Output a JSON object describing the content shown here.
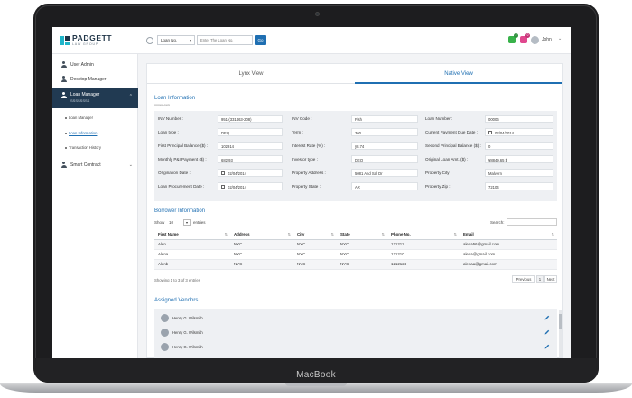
{
  "device": {
    "brand_label": "MacBook"
  },
  "header": {
    "logo_name": "PADGETT",
    "logo_sub": "LAW GROUP",
    "search_type": "Loan No.",
    "search_placeholder": "Enter The Loan No.",
    "go_label": "Go",
    "notif_green_count": "2",
    "notif_pink_count": "0",
    "user_name": "John",
    "accent_color": "#1f6fb2"
  },
  "sidebar": {
    "user_admin": "User Admin",
    "desktop_manager": "Desktop Manager",
    "loan_manager": "Loan Manager",
    "loan_manager_sub": "SSSSSSSS",
    "sub_items": [
      "Loan Manager",
      "Loan Information",
      "Transaction History"
    ],
    "smart_contract": "Smart Contract"
  },
  "tabs": {
    "lynx": "Lynx View",
    "native": "Native View"
  },
  "loan_info": {
    "title": "Loan Information",
    "subtitle": "000694/65",
    "fields": {
      "inv_number": {
        "label": "INV Number :",
        "value": "951-(331463-208)"
      },
      "inv_code": {
        "label": "INV Code :",
        "value": "Fish"
      },
      "loan_number": {
        "label": "Loan Number :",
        "value": "00006"
      },
      "loan_type": {
        "label": "Loan type :",
        "value": "DEQ"
      },
      "term": {
        "label": "Term :",
        "value": "360"
      },
      "payment_due": {
        "label": "Current Payment Due Date :",
        "value": "02/04/2014"
      },
      "first_principal": {
        "label": "First Principal Balance ($) :",
        "value": "102914"
      },
      "interest_rate": {
        "label": "Interest Rate (%) :",
        "value": "ÿ8.74"
      },
      "second_principal": {
        "label": "Second Principal Balance ($) :",
        "value": "0"
      },
      "monthly_payment": {
        "label": "Monthly P&I Payment ($) :",
        "value": "682.93"
      },
      "investor_type": {
        "label": "Investor type :",
        "value": "DEQ"
      },
      "original_loan": {
        "label": "Original Loan Amt. ($) :",
        "value": "¥8849.65 $"
      },
      "origination_date": {
        "label": "Origination Date :",
        "value": "02/04/2014"
      },
      "property_address": {
        "label": "Property Address :",
        "value": "5081 And Sal Dr"
      },
      "property_city": {
        "label": "Property City :",
        "value": "Malvern"
      },
      "procurement_date": {
        "label": "Loan Procurement Date :",
        "value": "02/04/2014"
      },
      "property_state": {
        "label": "Property State :",
        "value": "AR"
      },
      "property_zip": {
        "label": "Property Zip :",
        "value": "72104"
      }
    }
  },
  "borrower": {
    "title": "Borrower Information",
    "show_label": "Show",
    "entries_value": "10",
    "entries_label": "entries",
    "search_label": "Search:",
    "columns": [
      "First Name",
      "Address",
      "City",
      "State",
      "Phone No.",
      "Email"
    ],
    "rows": [
      [
        "Alen",
        "NYC",
        "NYC",
        "NYC",
        "121212",
        "alena56@gmail.com"
      ],
      [
        "Alena",
        "NYC",
        "NYC",
        "NYC",
        "121210",
        "alena@gmail.com"
      ],
      [
        "Alenb",
        "NYC",
        "NYC",
        "NYC",
        "1212124",
        "alenaa@gmail.com"
      ]
    ],
    "info": "Showing 1 to 3 of 3 entries",
    "prev": "Previous",
    "page": "1",
    "next": "Next"
  },
  "vendors": {
    "title": "Assigned Vendors",
    "items": [
      "Henry G. Wilsmith",
      "Henry G. Wilsmith",
      "Henry G. Wilsmith"
    ]
  }
}
